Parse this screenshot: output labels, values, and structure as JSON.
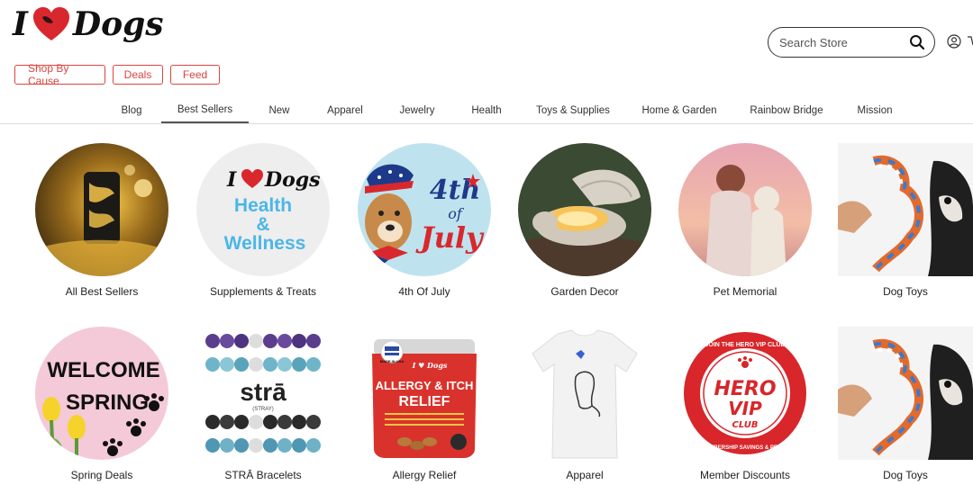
{
  "header": {
    "logo": {
      "i": "I",
      "dogs": "Dogs"
    },
    "search": {
      "placeholder": "Search Store"
    }
  },
  "pills": [
    "Shop By Cause",
    "Deals",
    "Feed"
  ],
  "nav": {
    "items": [
      "Blog",
      "Best Sellers",
      "New",
      "Apparel",
      "Jewelry",
      "Health",
      "Toys & Supplies",
      "Home & Garden",
      "Rainbow Bridge",
      "Mission"
    ],
    "active": "Best Sellers"
  },
  "categories": [
    {
      "label": "All Best Sellers"
    },
    {
      "label": "Supplements & Treats",
      "image_text": {
        "brand": "Dogs",
        "brand_i": "I",
        "line1": "Health",
        "line2": "&",
        "line3": "Wellness"
      }
    },
    {
      "label": "4th Of July",
      "image_text": {
        "a": "4th",
        "b": "of",
        "c": "July"
      }
    },
    {
      "label": "Garden Decor"
    },
    {
      "label": "Pet Memorial"
    },
    {
      "label": "Dog Toys"
    },
    {
      "label": "Spring Deals",
      "image_text": {
        "a": "WELCOME",
        "b": "SPRING"
      }
    },
    {
      "label": "STRĀ Bracelets",
      "image_text": {
        "a": "strā",
        "b": "(STRAY)"
      }
    },
    {
      "label": "Allergy Relief",
      "image_text": {
        "a": "ALLERGY & ITCH",
        "b": "RELIEF",
        "badge": "MADE IN USA",
        "brand": "I ♥ Dogs"
      }
    },
    {
      "label": "Apparel"
    },
    {
      "label": "Member Discounts",
      "image_text": {
        "a": "HERO",
        "b": "VIP",
        "c": "CLUB",
        "ring_top": "JOIN THE HERO VIP CLUB",
        "ring_bottom": "MEMBERSHIP SAVINGS & PERKS"
      }
    },
    {
      "label": "Dog Toys"
    }
  ],
  "colors": {
    "accent": "#d9453f",
    "heart": "#d8282e",
    "wellness_blue": "#4bb6e8",
    "vip_red": "#d8262a"
  }
}
